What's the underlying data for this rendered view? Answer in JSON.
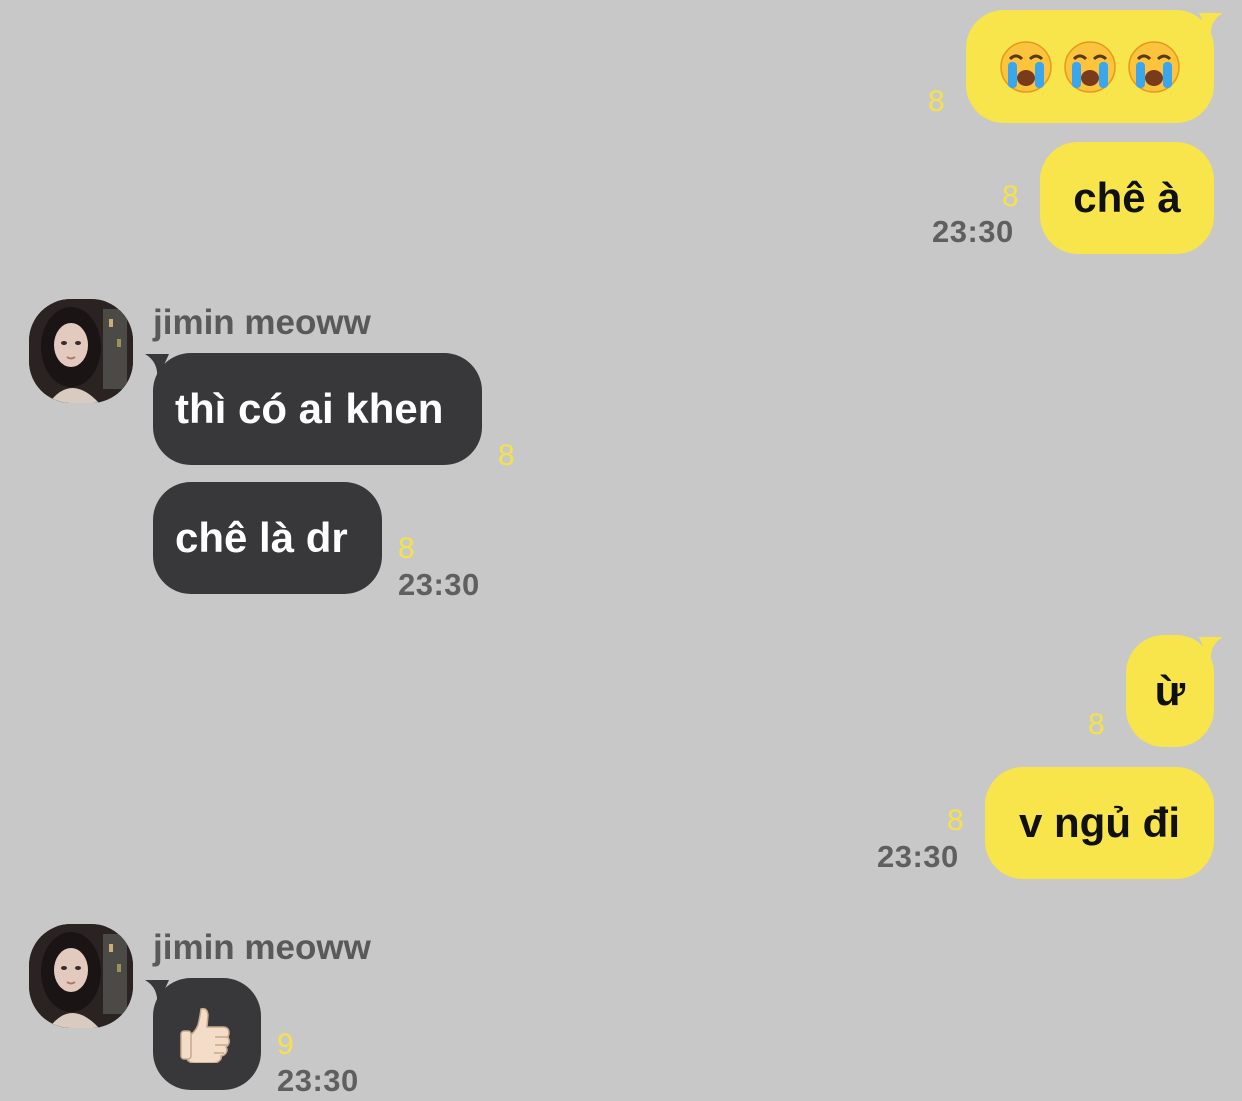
{
  "chat": {
    "sender_name": "jimin meoww",
    "messages": [
      {
        "id": "m1",
        "side": "sent",
        "content_icon": "crying-face-icon",
        "emoji_count": 3,
        "unread": "8"
      },
      {
        "id": "m2",
        "side": "sent",
        "text": "chê à",
        "unread": "8",
        "time": "23:30"
      },
      {
        "id": "m3",
        "side": "received",
        "text": "thì có ai khen",
        "unread": "8"
      },
      {
        "id": "m4",
        "side": "received",
        "text": "chê là dr",
        "unread": "8",
        "time": "23:30"
      },
      {
        "id": "m5",
        "side": "sent",
        "text": "ừ",
        "unread": "8"
      },
      {
        "id": "m6",
        "side": "sent",
        "text": "v ngủ đi",
        "unread": "8",
        "time": "23:30"
      },
      {
        "id": "m7",
        "side": "received",
        "content_icon": "thumbs-up-icon",
        "unread": "9",
        "time": "23:30"
      }
    ]
  },
  "colors": {
    "background": "#c8c8c8",
    "sent_bubble": "#f7e54b",
    "received_bubble": "#38383b",
    "unread_count": "#f5e24a",
    "timestamp": "#5f5f5f"
  }
}
